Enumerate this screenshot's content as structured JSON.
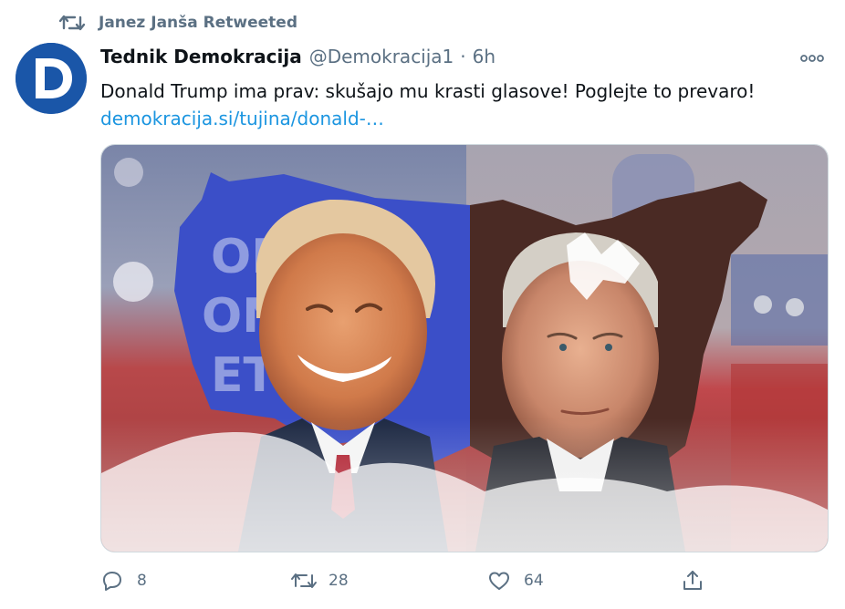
{
  "retweet_context": {
    "text": "Janez Janša Retweeted",
    "icon": "retweet-icon"
  },
  "tweet": {
    "author_name": "Tednik Demokracija",
    "handle": "@Demokracija1",
    "separator": "·",
    "time": "6h",
    "text": "Donald Trump ima prav: skušajo mu krasti glasove! Poglejte to prevaro!",
    "link": "demokracija.si/tujina/donald-…",
    "avatar_letter": "D",
    "avatar_icon": "demokracija-logo-icon",
    "more_icon": "more-options-icon",
    "media_icon": "trump-biden-usa-map-photo"
  },
  "actions": {
    "reply": {
      "icon": "reply-icon",
      "count": "8"
    },
    "retweet": {
      "icon": "retweet-icon",
      "count": "28"
    },
    "like": {
      "icon": "heart-icon",
      "count": "64"
    },
    "share": {
      "icon": "share-icon"
    }
  },
  "colors": {
    "text": "#0f1419",
    "secondary": "#5b7083",
    "link": "#1b95e0",
    "avatar_blue": "#1a56a8",
    "border": "#cfd9de"
  }
}
